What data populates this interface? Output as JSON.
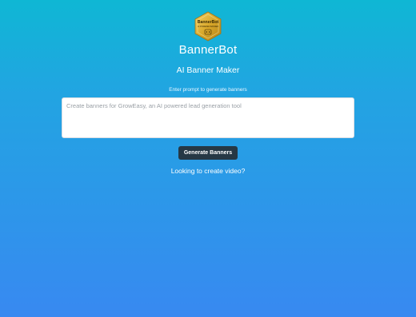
{
  "logo": {
    "line1": "BannerBot",
    "line2": "AI POWERED BANNER"
  },
  "header": {
    "title": "BannerBot",
    "subtitle": "AI Banner Maker"
  },
  "prompt": {
    "label": "Enter prompt to generate banners",
    "placeholder": "Create banners for GrowEasy, an AI powered lead generation tool",
    "value": ""
  },
  "actions": {
    "generate_label": "Generate Banners",
    "video_link": "Looking to create video?"
  },
  "colors": {
    "gradient_top": "#0fb7d4",
    "gradient_bottom": "#3889f1",
    "button_bg": "#263845",
    "logo_gold": "#d9a82a"
  }
}
